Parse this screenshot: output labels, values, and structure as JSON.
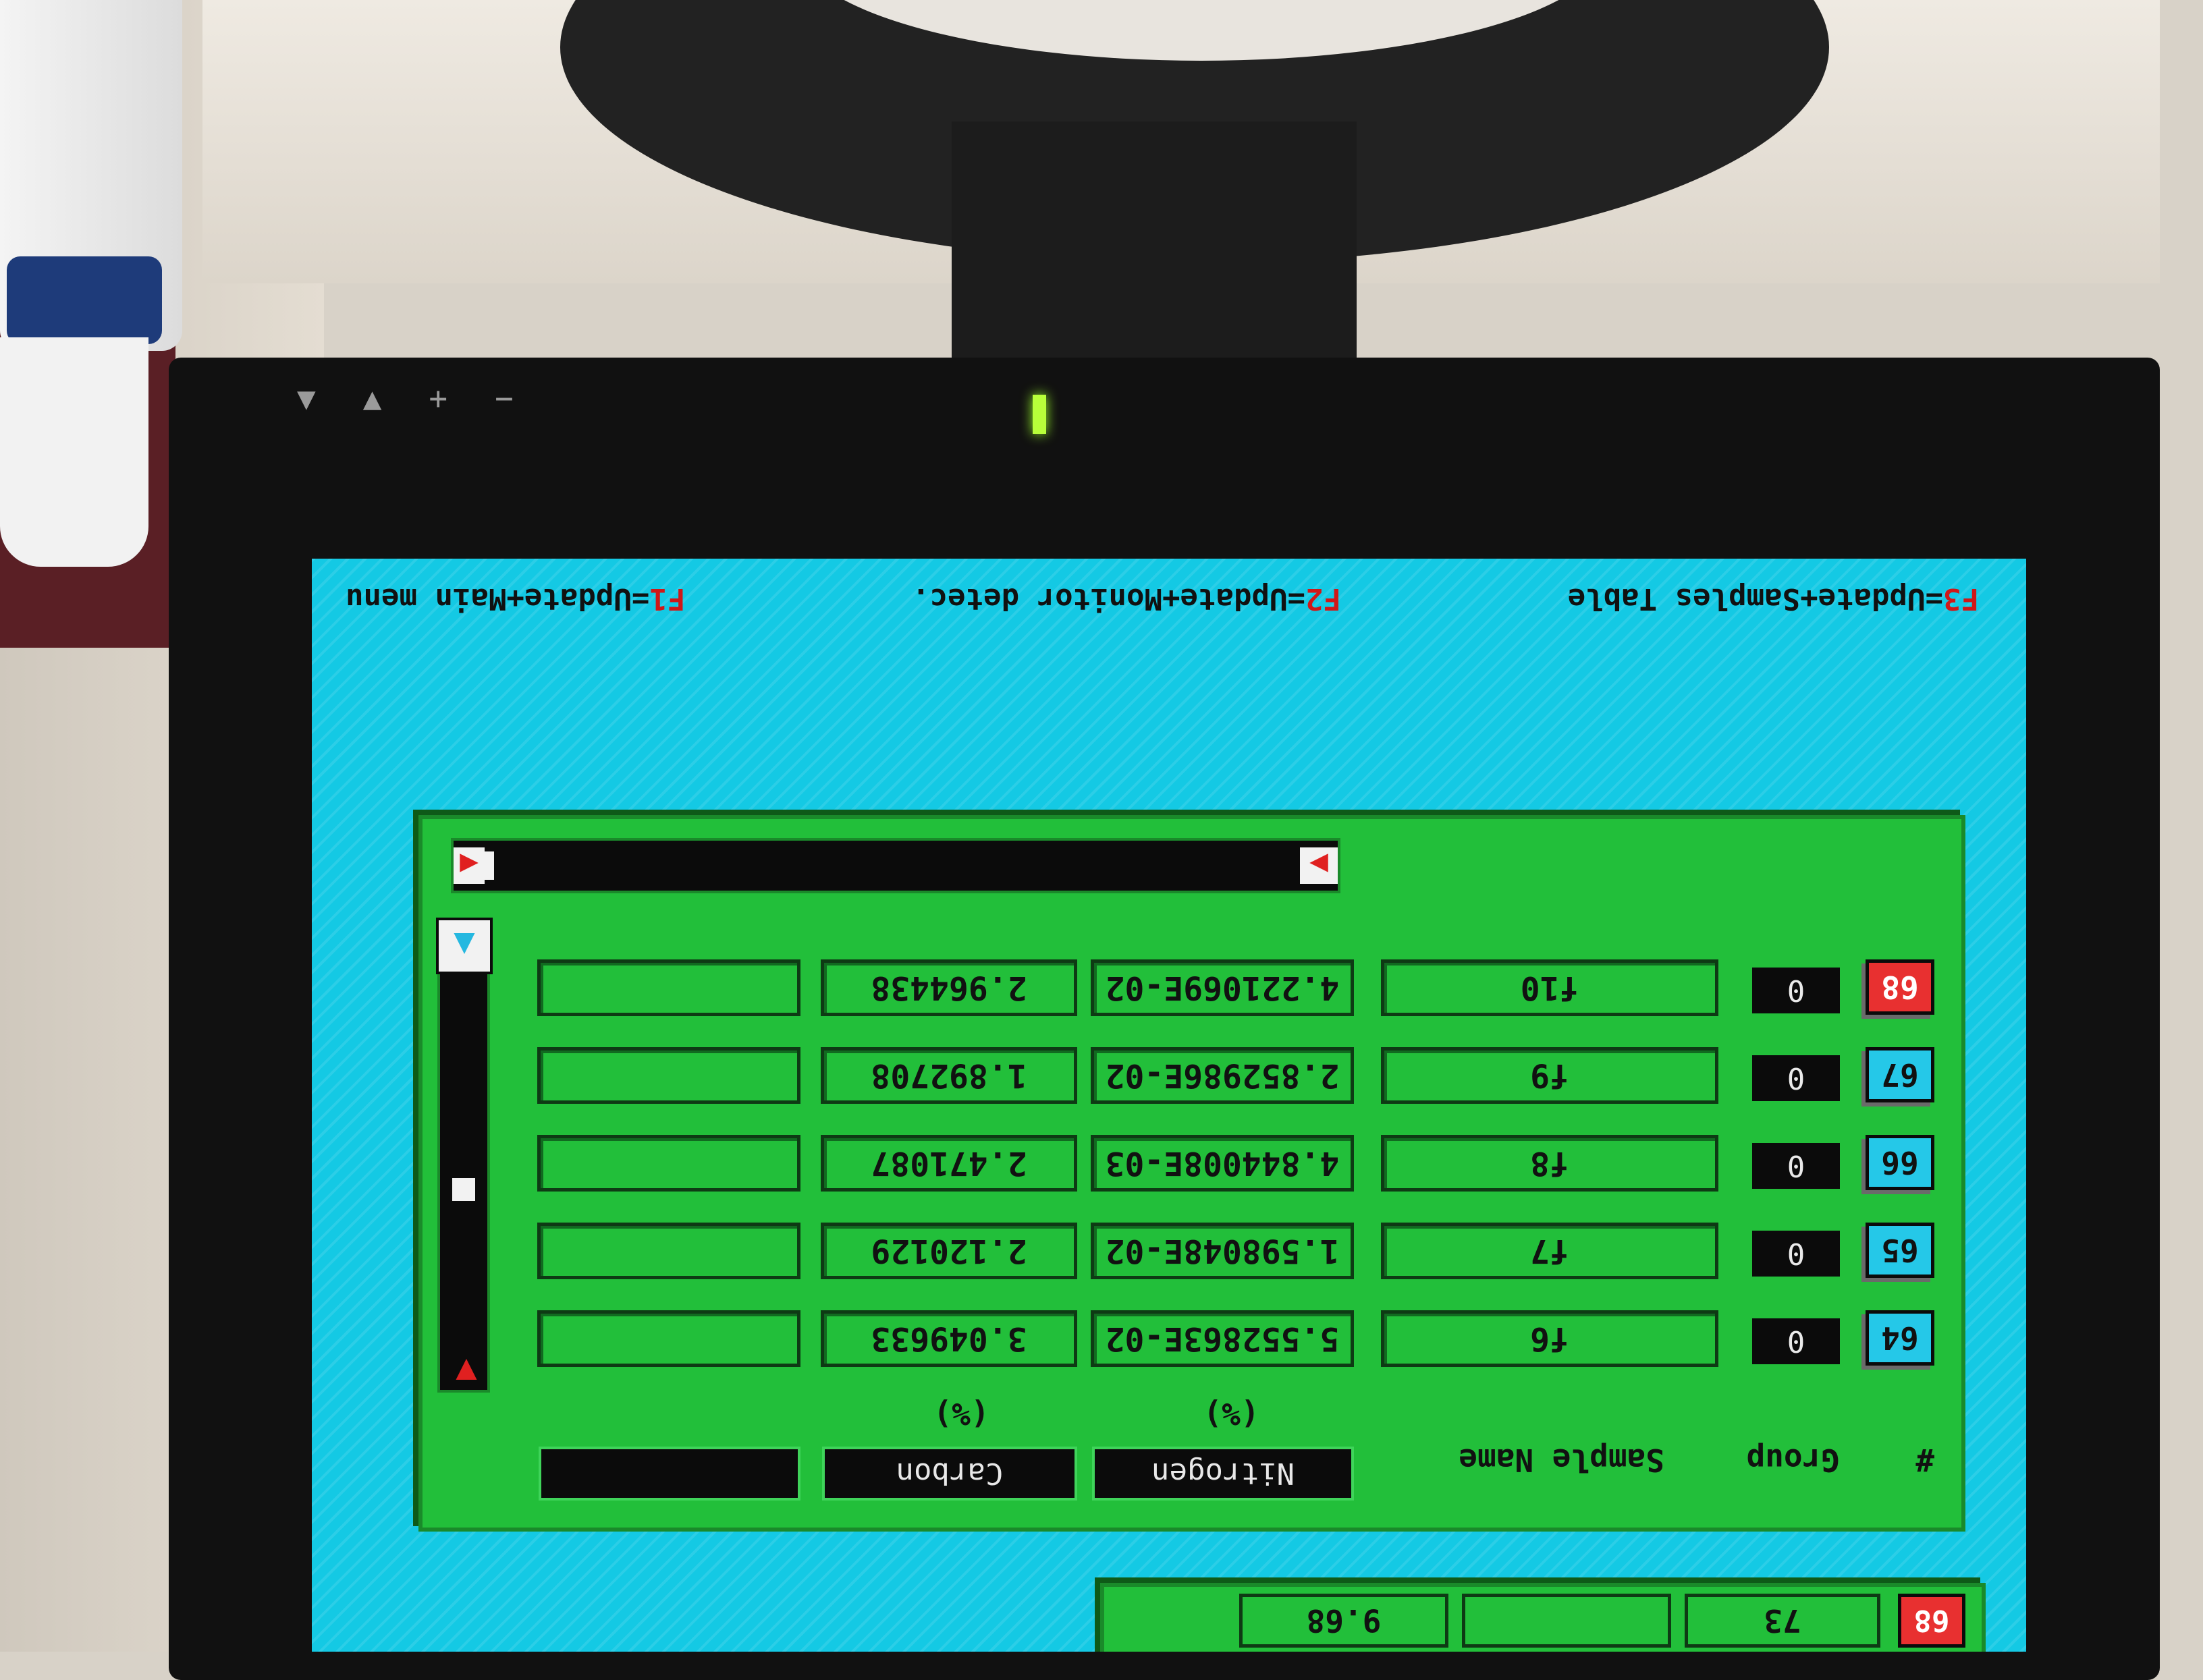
{
  "function_keys": [
    {
      "key": "F1",
      "label": "=Update+Main menu"
    },
    {
      "key": "F2",
      "label": "=Update+Monitor detec."
    },
    {
      "key": "F3",
      "label": "=Update+Samples Table"
    }
  ],
  "monitor": {
    "buttons": [
      "▼",
      "▲",
      "+",
      "−"
    ]
  },
  "table": {
    "headers": {
      "number": "#",
      "group": "Group",
      "sample_name": "Sample Name",
      "nitrogen": "Nitrogen",
      "nitrogen_unit": "(%)",
      "carbon": "Carbon",
      "carbon_unit": "(%)",
      "extra": ""
    },
    "rows": [
      {
        "num": "64",
        "group": "0",
        "name": "f6",
        "nitrogen": "5.552863E-02",
        "carbon": "3.049633",
        "extra": ""
      },
      {
        "num": "65",
        "group": "0",
        "name": "f7",
        "nitrogen": "1.598048E-02",
        "carbon": "2.120129",
        "extra": ""
      },
      {
        "num": "66",
        "group": "0",
        "name": "f8",
        "nitrogen": "4.844008E-03",
        "carbon": "2.471087",
        "extra": ""
      },
      {
        "num": "67",
        "group": "0",
        "name": "f9",
        "nitrogen": "2.852986E-02",
        "carbon": "1.892708",
        "extra": ""
      },
      {
        "num": "68",
        "group": "0",
        "name": "f10",
        "nitrogen": "4.221069E-02",
        "carbon": "2.964438",
        "extra": "",
        "active": true
      }
    ]
  },
  "second_table": {
    "num": "68",
    "col1": "73",
    "col2": "",
    "col3": "9.68"
  },
  "colors": {
    "screen_background": "#14c9e4",
    "panel_green": "#22bf3a",
    "active_row_red": "#e83030",
    "key_red": "#d01818"
  }
}
